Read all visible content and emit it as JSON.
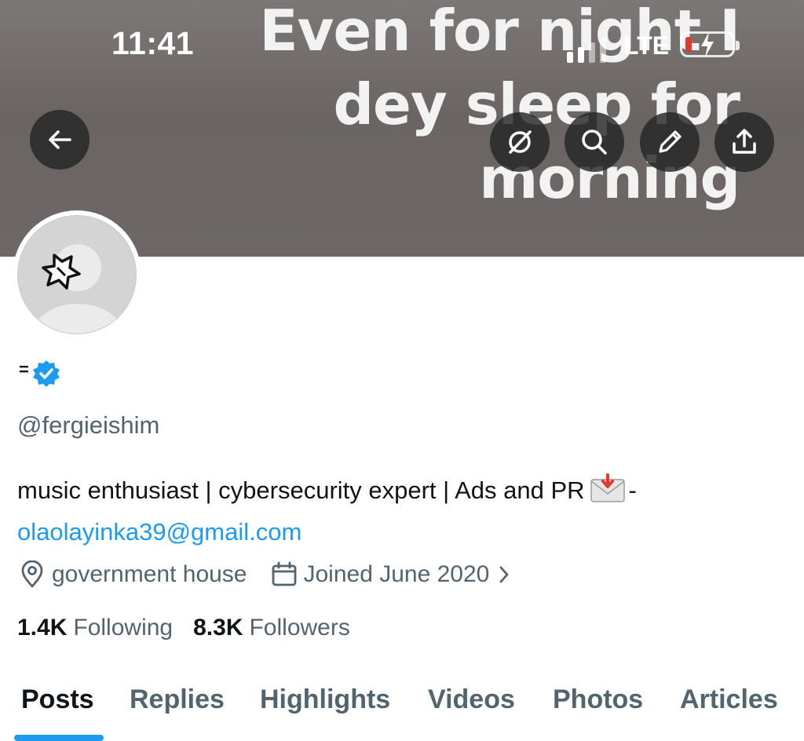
{
  "status_bar": {
    "time": "11:41",
    "network": "LTE",
    "battery_color": "#e0392d"
  },
  "banner": {
    "lines": [
      "Even for night I",
      "dey sleep for",
      "morning"
    ]
  },
  "header_actions": {
    "back_icon": "arrow-left-icon",
    "icons": [
      "grok-icon",
      "search-icon",
      "edit-icon",
      "share-icon"
    ]
  },
  "profile": {
    "name_glyph": "=",
    "verified": true,
    "verified_color": "#1d9bf0",
    "handle": "@fergieishim",
    "bio_text": "music enthusiast | cybersecurity expert | Ads and PR",
    "bio_suffix": "-",
    "bio_link": "olaolayinka39@gmail.com",
    "location": "government house",
    "joined": "Joined June 2020",
    "following_count": "1.4K",
    "following_label": "Following",
    "followers_count": "8.3K",
    "followers_label": "Followers"
  },
  "tabs": {
    "items": [
      {
        "label": "Posts",
        "active": true
      },
      {
        "label": "Replies",
        "active": false
      },
      {
        "label": "Highlights",
        "active": false
      },
      {
        "label": "Videos",
        "active": false
      },
      {
        "label": "Photos",
        "active": false
      },
      {
        "label": "Articles",
        "active": false
      }
    ]
  },
  "colors": {
    "accent": "#1d9bf0",
    "secondary_text": "#536471",
    "primary_text": "#0f1419"
  }
}
